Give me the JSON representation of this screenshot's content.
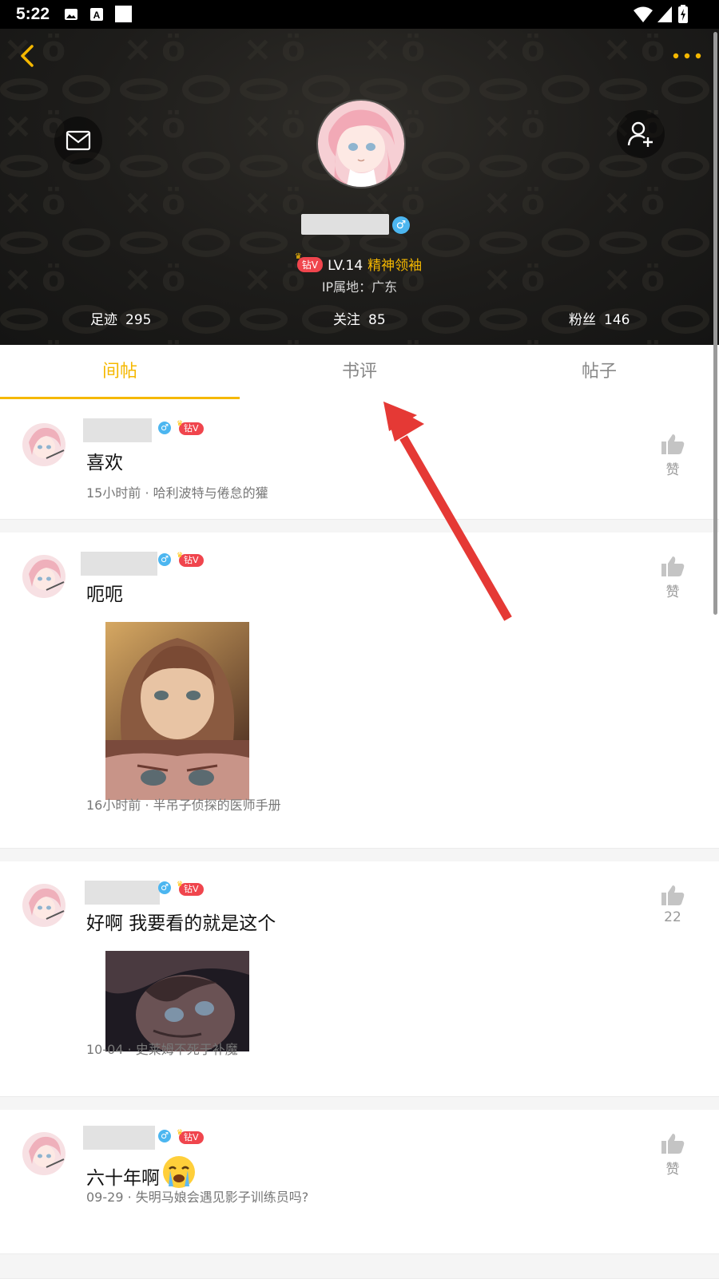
{
  "status_bar": {
    "time": "5:22"
  },
  "profile": {
    "vip_label": "钻V",
    "level": "LV.14",
    "title": "精神领袖",
    "ip_location": "IP属地：广东",
    "gender_symbol": "♂",
    "stats": [
      {
        "label": "足迹",
        "value": "295"
      },
      {
        "label": "关注",
        "value": "85"
      },
      {
        "label": "粉丝",
        "value": "146"
      }
    ]
  },
  "tabs": [
    {
      "label": "间帖",
      "active": true
    },
    {
      "label": "书评",
      "active": false
    },
    {
      "label": "帖子",
      "active": false
    }
  ],
  "items": [
    {
      "text": "喜欢",
      "meta": "15小时前 · 哈利波特与倦怠的獾",
      "like_label": "赞",
      "vip_label": "钻V"
    },
    {
      "text": "呃呃",
      "meta": "16小时前 · 半吊子侦探的医师手册",
      "like_label": "赞",
      "vip_label": "钻V"
    },
    {
      "text": "好啊 我要看的就是这个",
      "meta": "10-04 · 史莱姆不死于补魔",
      "like_label": "22",
      "vip_label": "钻V"
    },
    {
      "text": "六十年啊",
      "meta": "09-29 · 失明马娘会遇见影子训练员吗?",
      "like_label": "赞",
      "vip_label": "钻V"
    }
  ],
  "colors": {
    "accent": "#f5b800",
    "vip": "#f0454d",
    "gender": "#4cb6f0",
    "arrow": "#e53935"
  }
}
